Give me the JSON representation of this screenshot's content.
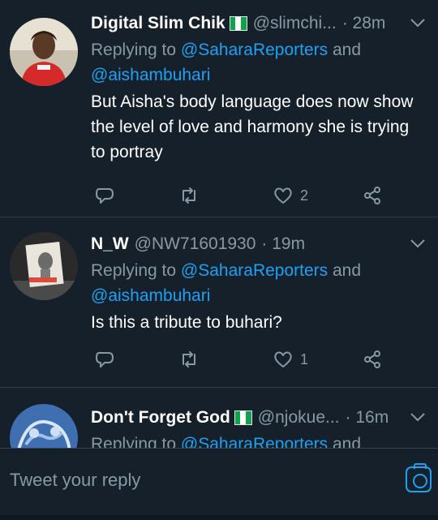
{
  "tweets": [
    {
      "name": "Digital Slim Chik",
      "handle": "@slimchi...",
      "time": "· 28m",
      "reply_prefix": "Replying to ",
      "reply_mention_1": "@SaharaReporters",
      "reply_and": " and",
      "reply_mention_2": "@aishambuhari",
      "text": "But Aisha's body language does now show the level of love and harmony she is trying to portray",
      "likes": "2"
    },
    {
      "name": "N_W",
      "handle": "@NW71601930",
      "time": "· 19m",
      "reply_prefix": "Replying to ",
      "reply_mention_1": "@SaharaReporters",
      "reply_and": " and",
      "reply_mention_2": "@aishambuhari",
      "text": "Is this a tribute to buhari?",
      "likes": "1"
    },
    {
      "name": "Don't Forget God",
      "handle": "@njokue...",
      "time": "· 16m",
      "reply_prefix": "Replying to ",
      "reply_mention_1": "@SaharaReporters",
      "reply_and": " and"
    }
  ],
  "composer": {
    "placeholder": "Tweet your reply"
  },
  "colors": {
    "background": "#15202b",
    "secondary_text": "#8899a6",
    "accent": "#1da1f2",
    "flag_green": "#11a34a"
  },
  "icons": [
    "reply-icon",
    "retweet-icon",
    "like-icon",
    "share-icon",
    "chevron-down-icon",
    "camera-icon",
    "nigeria-flag-icon"
  ]
}
